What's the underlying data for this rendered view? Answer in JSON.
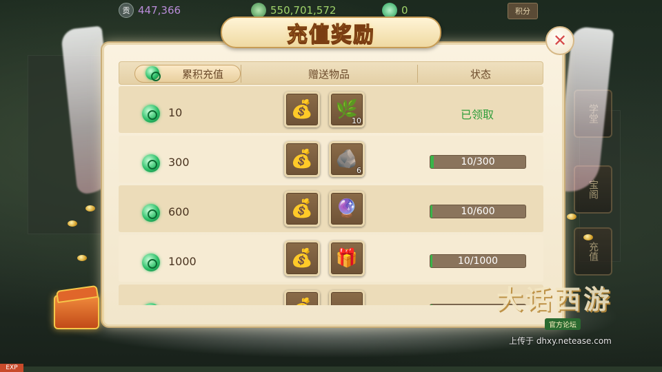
{
  "top_bar": {
    "currencies": [
      {
        "icon": "silver-coin-icon",
        "icon_glyph": "贡",
        "value": "447,366",
        "color": "#b98cd9"
      },
      {
        "icon": "jade-stack-icon",
        "icon_glyph": "",
        "value": "550,701,572",
        "color": "#9fd36a"
      },
      {
        "icon": "jade-icon",
        "icon_glyph": "",
        "value": "0",
        "color": "#9fd36a"
      }
    ],
    "score_button": "积分"
  },
  "side_buttons": [
    "学堂",
    "宝阁",
    "充值"
  ],
  "panel": {
    "title": "充值奖励",
    "close_glyph": "✕",
    "columns": {
      "cumulative": "累积充值",
      "gifts": "赠送物品",
      "status": "状态"
    },
    "rows": [
      {
        "amount": "10",
        "items": [
          {
            "icon": "treasure-bag-icon",
            "glyph": "💰",
            "qty": ""
          },
          {
            "icon": "herb-bottle-icon",
            "glyph": "🌿",
            "qty": "10"
          }
        ],
        "status_type": "claimed",
        "status_text": "已领取"
      },
      {
        "amount": "300",
        "items": [
          {
            "icon": "treasure-bag-icon",
            "glyph": "💰",
            "qty": ""
          },
          {
            "icon": "dark-ore-icon",
            "glyph": "🪨",
            "qty": "6"
          }
        ],
        "status_type": "progress",
        "progress_text": "10/300",
        "progress_fraction": 0.033
      },
      {
        "amount": "600",
        "items": [
          {
            "icon": "treasure-bag-icon",
            "glyph": "💰",
            "qty": ""
          },
          {
            "icon": "crystal-orb-icon",
            "glyph": "🔮",
            "qty": ""
          }
        ],
        "status_type": "progress",
        "progress_text": "10/600",
        "progress_fraction": 0.017
      },
      {
        "amount": "1000",
        "items": [
          {
            "icon": "treasure-bag-icon",
            "glyph": "💰",
            "qty": ""
          },
          {
            "icon": "gift-pouch-icon",
            "glyph": "🎁",
            "qty": ""
          }
        ],
        "status_type": "progress",
        "progress_text": "10/1000",
        "progress_fraction": 0.01
      },
      {
        "amount": "",
        "items": [
          {
            "icon": "treasure-bag-icon",
            "glyph": "💰",
            "qty": ""
          },
          {
            "icon": "red-pouch-icon",
            "glyph": "👝",
            "qty": ""
          }
        ],
        "status_type": "progress",
        "progress_text": "",
        "progress_fraction": 0.01
      }
    ]
  },
  "branding": {
    "logo_text": "大话西游",
    "logo_sub": "官方论坛",
    "watermark": "上传于 dhxy.netease.com"
  },
  "exp_label": "EXP"
}
